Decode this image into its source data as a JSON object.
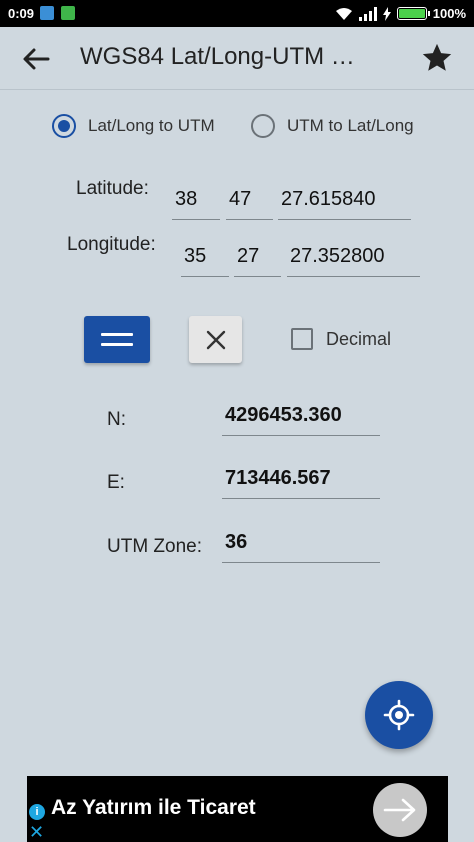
{
  "status_bar": {
    "time": "0:09",
    "battery_text": "100%",
    "battery_level": 1.0
  },
  "app_bar": {
    "title": "WGS84 Lat/Long-UTM …",
    "back_icon": "arrow-left-icon",
    "star_icon": "star-icon"
  },
  "mode": {
    "options": [
      {
        "label": "Lat/Long to UTM",
        "checked": true
      },
      {
        "label": "UTM to Lat/Long",
        "checked": false
      }
    ]
  },
  "latitude": {
    "label": "Latitude:",
    "deg": "38",
    "min": "47",
    "sec": "27.615840"
  },
  "longitude": {
    "label": "Longitude:",
    "deg": "35",
    "min": "27",
    "sec": "27.352800"
  },
  "actions": {
    "calculate_icon": "equals-icon",
    "clear_icon": "close-icon",
    "decimal_label": "Decimal",
    "decimal_checked": false
  },
  "result": {
    "n_label": "N:",
    "n_value": "4296453.360",
    "e_label": "E:",
    "e_value": "713446.567",
    "zone_label": "UTM Zone:",
    "zone_value": "36"
  },
  "fab": {
    "icon": "my-location-icon"
  },
  "ad": {
    "text": "Az Yatırım ile Ticaret",
    "info_icon": "info-icon",
    "close_icon": "close-icon",
    "arrow_icon": "arrow-right-icon"
  },
  "colors": {
    "accent": "#1a4fa3",
    "background": "#cfd8df"
  }
}
